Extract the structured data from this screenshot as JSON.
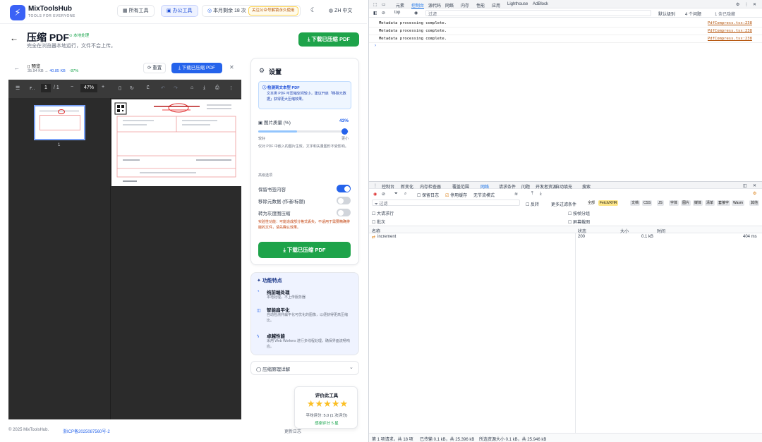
{
  "app": {
    "brand": "MixToolsHub",
    "brand_sub": "TOOLS FOR EVERYONE",
    "nav": [
      "所有工具",
      "办公工具",
      "本月剩余 18 次"
    ],
    "notice": "关注公众号解锁永久使用",
    "lang": "ZH 中文",
    "title": "压缩 PDF",
    "badge": "本地处理",
    "subtitle": "完全在浏览器本地运行，文件不会上传。",
    "download_top": "下载已压缩 PDF",
    "file": {
      "label": "预览",
      "orig_size": "35.94 KB",
      "arrow": "→",
      "new_size": "40.85 KB",
      "change": "-87%",
      "reset": "重置",
      "download": "下载已压缩 PDF"
    },
    "viewer": {
      "page_current": "1",
      "page_total": "/ 1",
      "zoom": "47%",
      "thumb_label": "1"
    },
    "settings": {
      "title": "设置",
      "tip_title": "检测到文本型 PDF",
      "tip_body": "文本类 PDF 可压缩空间较小，建议开启「移除元数据」获得更大压缩效果。",
      "quality_label": "图片质量 (%)",
      "quality_value": "43%",
      "quality_level": 0.43,
      "scale_left": "较好",
      "scale_right": "更小",
      "quality_hint": "仅对 PDF 中嵌入的图片生效，文字和矢量图形不受影响。",
      "advanced": "高级选项",
      "opt1": "保留书签内容",
      "opt2": "移除元数据 (作者/标题)",
      "opt3": "转为灰度图压缩",
      "warn": "实验性功能：可能造成部分格式丢失，不适用于需要精确排版的文件，请先确认效果。",
      "cta": "下载已压缩 PDF"
    },
    "features": {
      "title": "功能特点",
      "items": [
        {
          "title": "纯前端处理",
          "desc": "本地处理，不上传服务器"
        },
        {
          "title": "智能扁平化",
          "desc": "自动检测并扁平化可优化的图像，以便获得更高压缩比。"
        },
        {
          "title": "卓越性能",
          "desc": "采用 Web Workers 进行多线程处理，确保界面流畅响应。"
        }
      ]
    },
    "faq": "压缩原理详解",
    "rating": {
      "title": "评价此工具",
      "stars": 5,
      "avg": "平均评分: 5.0 (1 次评分)",
      "thanks": "感谢评分 5 星"
    },
    "footer": {
      "copyright": "© 2025 MixToolsHub.",
      "icp": "浙ICP备2025087560号-2",
      "update": "更新日志"
    }
  },
  "devtools": {
    "top_tabs": [
      "元素",
      "控制台",
      "源代码",
      "网络",
      "内存",
      "性能",
      "应用",
      "Lighthouse",
      "AdBlock"
    ],
    "context": "top",
    "filter": "过滤",
    "levels": "默认级别",
    "issues": "4 个问题",
    "hidden": "1 条已隐藏",
    "console_logs": [
      {
        "msg": "Metadata processing complete.",
        "src": "PdfCompress.tsx:238"
      },
      {
        "msg": "Metadata processing complete.",
        "src": "PdfCompress.tsx:238"
      },
      {
        "msg": "Metadata processing complete.",
        "src": "PdfCompress.tsx:238"
      }
    ],
    "prompt": "›",
    "drawer_tabs": [
      "控制台",
      "新变化",
      "内存检查器",
      "覆盖范围",
      "网络",
      "请求条件",
      "问题",
      "开发者资源",
      "自动填充",
      "搜索"
    ],
    "net_filter": "过滤",
    "preserve_log": "保留日志",
    "disable_cache": "停用缓存",
    "throttle": "无节流模式",
    "invert": "反转",
    "more_filters": "更多过滤条件",
    "types": [
      "全部",
      "Fetch/XHR",
      "文档",
      "CSS",
      "JS",
      "字体",
      "图片",
      "媒体",
      "清单",
      "套接字",
      "Wasm",
      "其他"
    ],
    "checkboxes": [
      "大请求行",
      "批次",
      "按帧分组",
      "屏幕截图"
    ],
    "columns": [
      "名称",
      "状态",
      "大小",
      "时间"
    ],
    "rows": [
      {
        "name": "increment",
        "status": "200",
        "size": "0.1 kB",
        "time": "404 ms"
      }
    ],
    "status_bar": [
      "第 1 项请求，共 18 项",
      "已传输 0.1 kB，共 25.396 kB",
      "所选资源大小 0.1 kB，共 25.946 kB"
    ]
  }
}
